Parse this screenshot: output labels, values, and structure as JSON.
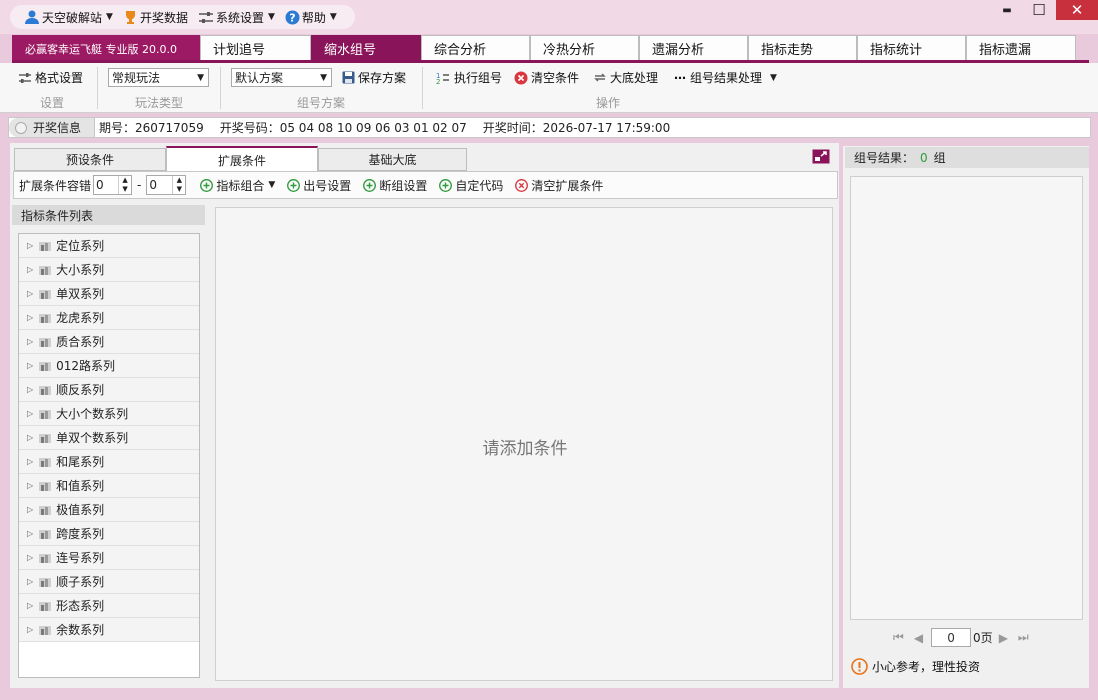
{
  "menu": {
    "user": "天空破解站",
    "draw_data": "开奖数据",
    "settings": "系统设置",
    "help": "帮助"
  },
  "window": {
    "close": "✕",
    "minimize": "▬",
    "maximize": "☐"
  },
  "tabs": [
    "必赢客幸运飞艇 专业版 20.0.0",
    "计划追号",
    "缩水组号",
    "综合分析",
    "冷热分析",
    "遗漏分析",
    "指标走势",
    "指标统计",
    "指标遗漏"
  ],
  "toolbar": {
    "format_settings": "格式设置",
    "play_type_value": "常规玩法",
    "scheme_value": "默认方案",
    "save_scheme": "保存方案",
    "execute": "执行组号",
    "clear_conditions": "清空条件",
    "base_process": "大底处理",
    "result_process": "组号结果处理",
    "groups": {
      "settings": "设置",
      "play_type": "玩法类型",
      "scheme": "组号方案",
      "operation": "操作"
    }
  },
  "info": {
    "label": "开奖信息",
    "period": "期号：260717059",
    "numbers": "开奖号码：05 04 08 10 09 06 03 01 02 07",
    "time": "开奖时间：2026-07-17 17:59:00"
  },
  "subtabs": [
    "预设条件",
    "扩展条件",
    "基础大底"
  ],
  "ext": {
    "tolerance_label": "扩展条件容错",
    "min": "0",
    "dash": "-",
    "max": "0",
    "indicator_combo": "指标组合",
    "output_settings": "出号设置",
    "break_settings": "断组设置",
    "custom_code": "自定代码",
    "clear_ext": "清空扩展条件"
  },
  "list": {
    "title": "指标条件列表",
    "items": [
      "定位系列",
      "大小系列",
      "单双系列",
      "龙虎系列",
      "质合系列",
      "012路系列",
      "顺反系列",
      "大小个数系列",
      "单双个数系列",
      "和尾系列",
      "和值系列",
      "极值系列",
      "跨度系列",
      "连号系列",
      "顺子系列",
      "形态系列",
      "余数系列"
    ]
  },
  "work": {
    "placeholder": "请添加条件"
  },
  "result": {
    "label": "组号结果：",
    "count": "0",
    "unit": "组",
    "page_value": "0",
    "page_suffix": "0页",
    "warning": "小心参考，理性投资"
  },
  "colors": {
    "accent": "#8a145a",
    "brand": "#9c1a63",
    "green": "#2e9b3a",
    "red": "#d9363e",
    "blue": "#2b7bd4",
    "orange": "#e8711a"
  }
}
